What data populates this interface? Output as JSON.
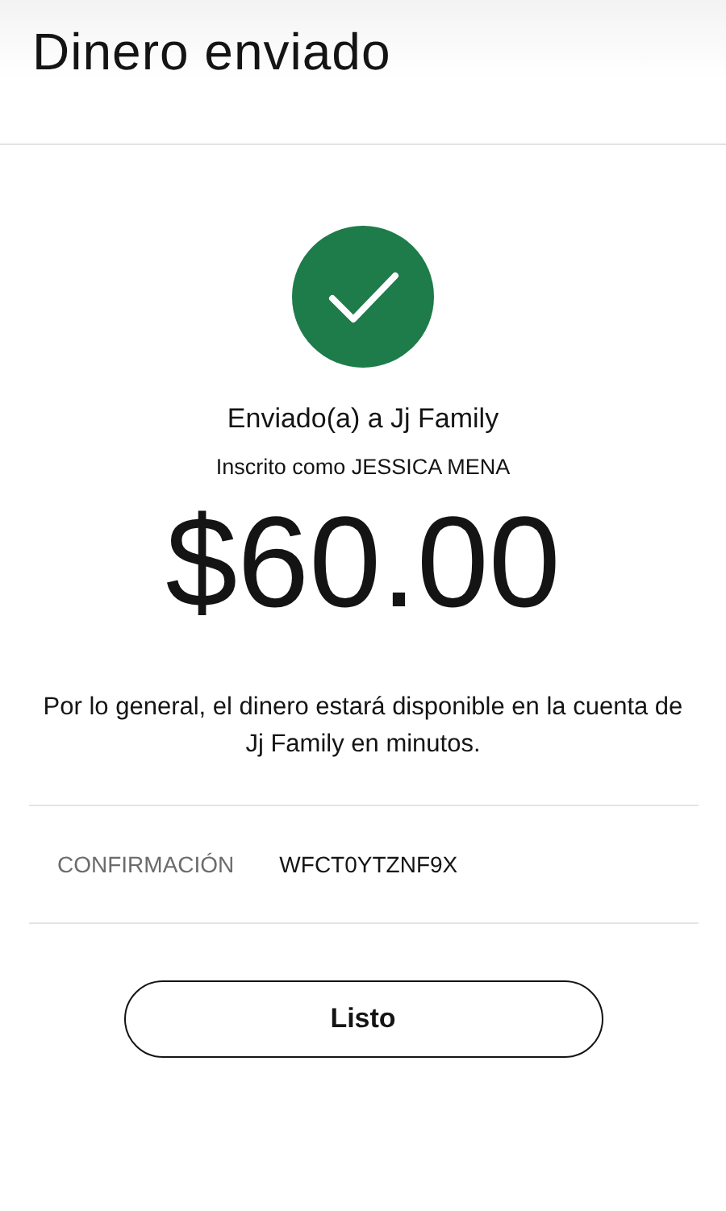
{
  "header": {
    "title": "Dinero enviado"
  },
  "status": {
    "kind": "success",
    "recipient_line": "Enviado(a) a Jj Family",
    "enrolled_line": "Inscrito como JESSICA MENA",
    "amount": "$60.00"
  },
  "message": "Por lo general, el dinero estará disponible en la cuenta de Jj Family en minutos.",
  "confirmation": {
    "label": "CONFIRMACIÓN",
    "code": "WFCT0YTZNF9X"
  },
  "buttons": [
    "Listo"
  ]
}
